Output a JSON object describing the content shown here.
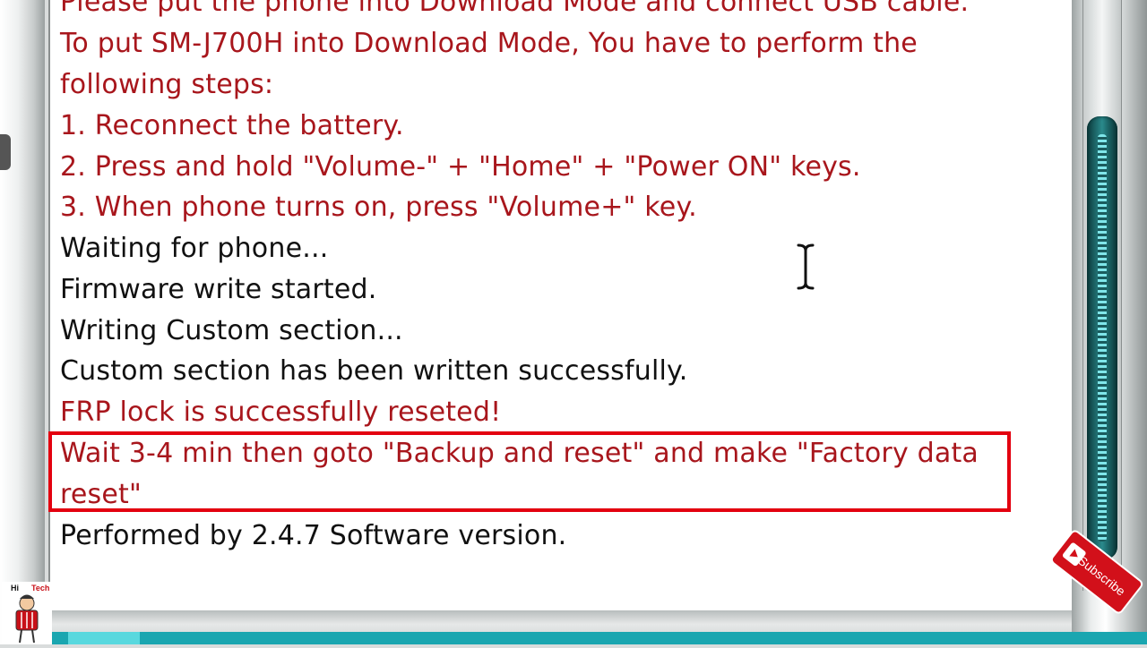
{
  "log": {
    "lines": [
      {
        "text": "Please put the phone into Download Mode and connect USB cable.",
        "color": "#a8161c"
      },
      {
        "text": "To put SM-J700H into Download Mode, You have to perform the",
        "color": "#a8161c"
      },
      {
        "text": " following steps:",
        "color": "#a8161c"
      },
      {
        "text": "1. Reconnect the battery.",
        "color": "#a8161c"
      },
      {
        "text": "2. Press and hold \"Volume-\" + \"Home\" + \"Power ON\" keys.",
        "color": "#a8161c"
      },
      {
        "text": "3. When phone turns on, press \"Volume+\" key.",
        "color": "#a8161c"
      },
      {
        "text": "Waiting for phone...",
        "color": "#111111"
      },
      {
        "text": "Firmware write started.",
        "color": "#111111"
      },
      {
        "text": "Writing Custom section...",
        "color": "#111111"
      },
      {
        "text": "Custom section has been written successfully.",
        "color": "#111111"
      },
      {
        "text": "FRP lock is successfully reseted!",
        "color": "#a8161c"
      },
      {
        "text": "Wait 3-4 min then goto \"Backup and reset\" and make \"Factory data",
        "color": "#a8161c"
      },
      {
        "text": "reset\"",
        "color": "#a8161c"
      },
      {
        "text": "Performed by 2.4.7 Software version.",
        "color": "#111111"
      }
    ],
    "highlight_color": "#e3000f"
  },
  "overlay": {
    "subscribe_label": "Subscribe",
    "channel_logo_text": "Hi",
    "channel_logo_text2": "Tech"
  },
  "icons": {
    "cursor": "text-cursor-icon",
    "play": "play-icon"
  }
}
